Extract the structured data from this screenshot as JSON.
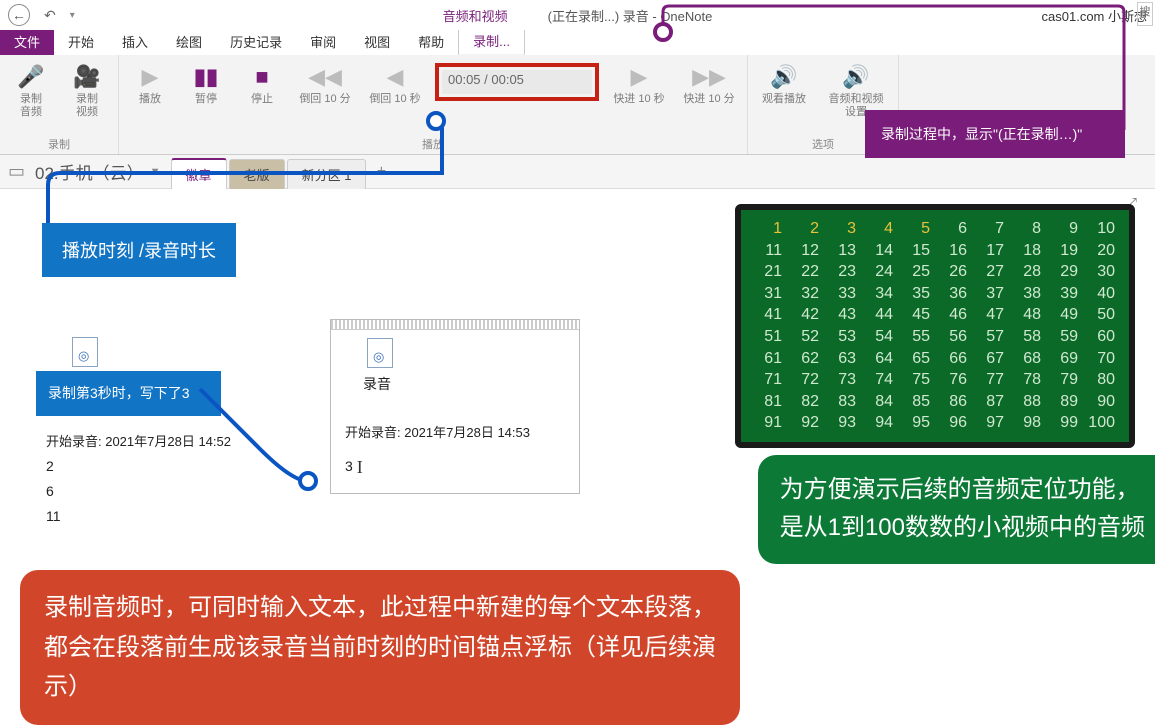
{
  "titlebar": {
    "contextual": "音频和视频",
    "doc": "(正在录制...) 录音  -  OneNote",
    "account": "cas01.com 小斯想"
  },
  "tabs": {
    "file": "文件",
    "items": [
      "开始",
      "插入",
      "绘图",
      "历史记录",
      "审阅",
      "视图",
      "帮助",
      "录制..."
    ]
  },
  "ribbon": {
    "rec_audio": "录制\n音频",
    "rec_video": "录制\n视频",
    "grp_rec": "录制",
    "play": "播放",
    "pause": "暂停",
    "stop": "停止",
    "back10m": "倒回 10 分",
    "back10s": "倒回 10 秒",
    "fwd10s": "快进 10 秒",
    "fwd10m": "快进 10 分",
    "timecode": "00:05 / 00:05",
    "grp_play": "播放",
    "watch": "观看播放",
    "av_settings": "音频和视频\n设置",
    "grp_opt": "选项"
  },
  "annot": {
    "purple": "录制过程中，显示\"(正在录制…)\"",
    "blue1": "播放时刻 /录音时长",
    "blue2": "录制第3秒时，写下了3",
    "green": "为方便演示后续的音频定位功能，\n是从1到100数数的小视频中的音频",
    "red": "录制音频时，可同时输入文本，此过程中新建的每个文本段落，都会在段落前生成该录音当前时刻的时间锚点浮标（详见后续演示）"
  },
  "nb": {
    "name": "02.手机（云）",
    "sections": [
      "徽章",
      "老版",
      "新分区 1"
    ]
  },
  "page": {
    "left_ts": "开始录音: 2021年7月28日  14:52",
    "left_lines": [
      "2",
      "6",
      "11"
    ],
    "sel_file": "录音",
    "sel_ts": "开始录音: 2021年7月28日  14:53",
    "sel_line": "3"
  },
  "tv": {
    "rows": [
      [
        "1",
        "2",
        "3",
        "4",
        "5",
        "6",
        "7",
        "8",
        "9",
        "10"
      ],
      [
        "11",
        "12",
        "13",
        "14",
        "15",
        "16",
        "17",
        "18",
        "19",
        "20"
      ],
      [
        "21",
        "22",
        "23",
        "24",
        "25",
        "26",
        "27",
        "28",
        "29",
        "30"
      ],
      [
        "31",
        "32",
        "33",
        "34",
        "35",
        "36",
        "37",
        "38",
        "39",
        "40"
      ],
      [
        "41",
        "42",
        "43",
        "44",
        "45",
        "46",
        "47",
        "48",
        "49",
        "50"
      ],
      [
        "51",
        "52",
        "53",
        "54",
        "55",
        "56",
        "57",
        "58",
        "59",
        "60"
      ],
      [
        "61",
        "62",
        "63",
        "64",
        "65",
        "66",
        "67",
        "68",
        "69",
        "70"
      ],
      [
        "71",
        "72",
        "73",
        "74",
        "75",
        "76",
        "77",
        "78",
        "79",
        "80"
      ],
      [
        "81",
        "82",
        "83",
        "84",
        "85",
        "86",
        "87",
        "88",
        "89",
        "90"
      ],
      [
        "91",
        "92",
        "93",
        "94",
        "95",
        "96",
        "97",
        "98",
        "99",
        "100"
      ]
    ]
  }
}
